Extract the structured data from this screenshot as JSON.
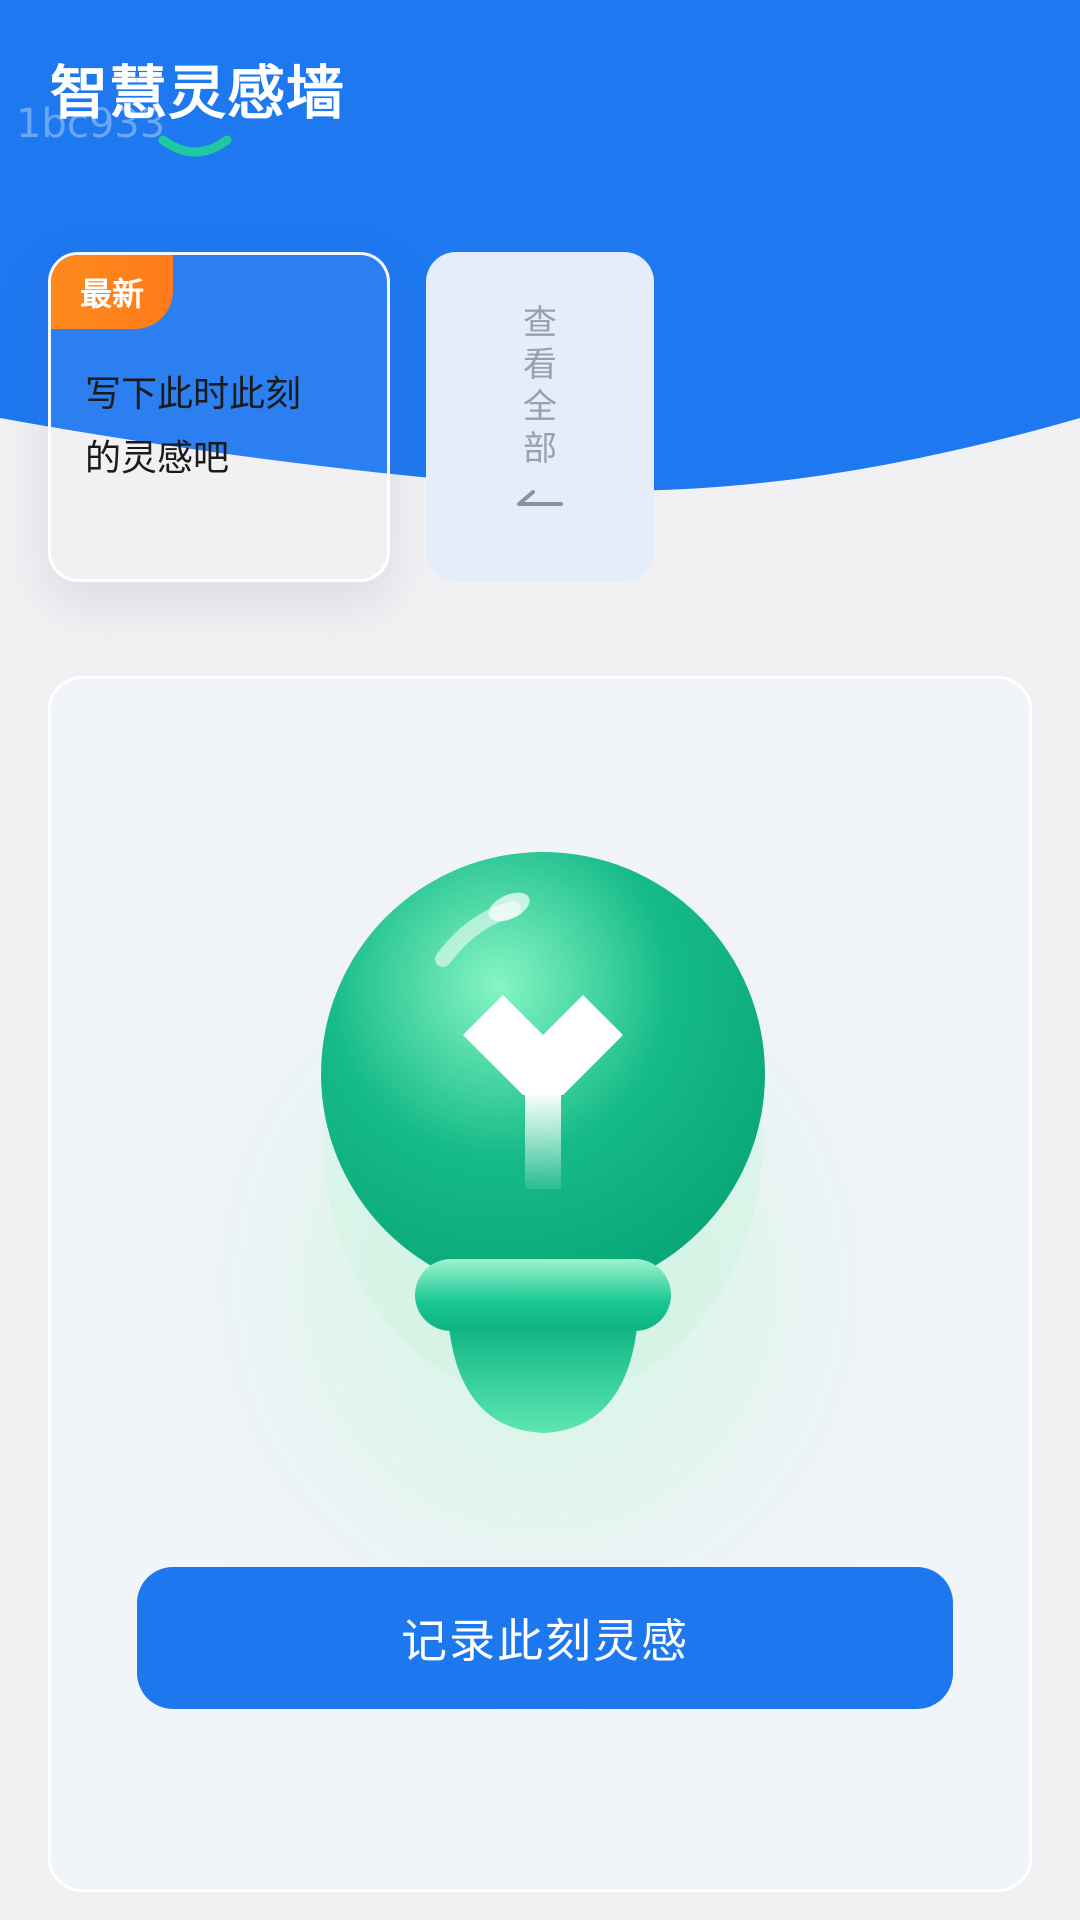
{
  "header": {
    "title": "智慧灵感墙",
    "watermark": "1bc933"
  },
  "latest_card": {
    "badge": "最新",
    "prompt_line1": "写下此时此刻",
    "prompt_line2": "的灵感吧"
  },
  "view_all": {
    "label": "查看全部"
  },
  "main": {
    "record_button_label": "记录此刻灵感"
  },
  "colors": {
    "primary_blue": "#1e78f0",
    "badge_orange": "#fd861c",
    "bulb_green": "#2ed39a",
    "accent_teal": "#1fc8a0"
  },
  "icons": {
    "title_decoration": "smile-curve-icon",
    "view_all_arrow": "arrow-left-icon",
    "illustration": "lightbulb-icon"
  }
}
